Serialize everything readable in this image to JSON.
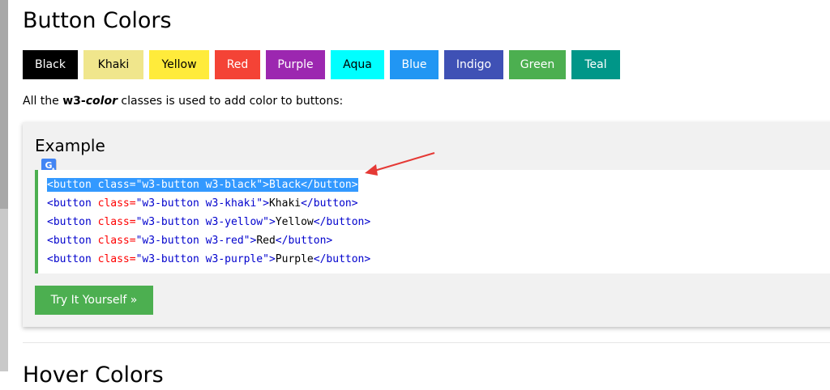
{
  "page": {
    "title": "Button Colors",
    "intro_prefix": "All the ",
    "intro_bold": "w3-",
    "intro_bold_italic": "color",
    "intro_suffix": " classes is used to add color to buttons:",
    "next_heading": "Hover Colors"
  },
  "buttons": [
    {
      "label": "Black",
      "bg": "#000000",
      "fg": "#ffffff"
    },
    {
      "label": "Khaki",
      "bg": "#f0e68c",
      "fg": "#000000"
    },
    {
      "label": "Yellow",
      "bg": "#ffeb3b",
      "fg": "#000000"
    },
    {
      "label": "Red",
      "bg": "#f44336",
      "fg": "#ffffff"
    },
    {
      "label": "Purple",
      "bg": "#9c27b0",
      "fg": "#ffffff"
    },
    {
      "label": "Aqua",
      "bg": "#00ffff",
      "fg": "#000000"
    },
    {
      "label": "Blue",
      "bg": "#2196f3",
      "fg": "#ffffff"
    },
    {
      "label": "Indigo",
      "bg": "#3f51b5",
      "fg": "#ffffff"
    },
    {
      "label": "Green",
      "bg": "#4caf50",
      "fg": "#ffffff"
    },
    {
      "label": "Teal",
      "bg": "#009688",
      "fg": "#ffffff"
    }
  ],
  "example": {
    "heading": "Example",
    "translate_icon": "google-translate-icon",
    "translate_glyph": "G",
    "translate_sub": "A",
    "code_lines": [
      {
        "open": "<button ",
        "attr": "class=",
        "val": "\"w3-button w3-black\"",
        "close_open": ">",
        "text": "Black",
        "end": "</button>"
      },
      {
        "open": "<button ",
        "attr": "class=",
        "val": "\"w3-button w3-khaki\"",
        "close_open": ">",
        "text": "Khaki",
        "end": "</button>"
      },
      {
        "open": "<button ",
        "attr": "class=",
        "val": "\"w3-button w3-yellow\"",
        "close_open": ">",
        "text": "Yellow",
        "end": "</button>"
      },
      {
        "open": "<button ",
        "attr": "class=",
        "val": "\"w3-button w3-red\"",
        "close_open": ">",
        "text": "Red",
        "end": "</button>"
      },
      {
        "open": "<button ",
        "attr": "class=",
        "val": "\"w3-button w3-purple\"",
        "close_open": ">",
        "text": "Purple",
        "end": "</button>"
      }
    ],
    "selected_line": 0,
    "try_button": "Try It Yourself »"
  },
  "colors": {
    "accent_green": "#4caf50",
    "selection": "#3399ff",
    "annotation_arrow": "#e53935"
  }
}
